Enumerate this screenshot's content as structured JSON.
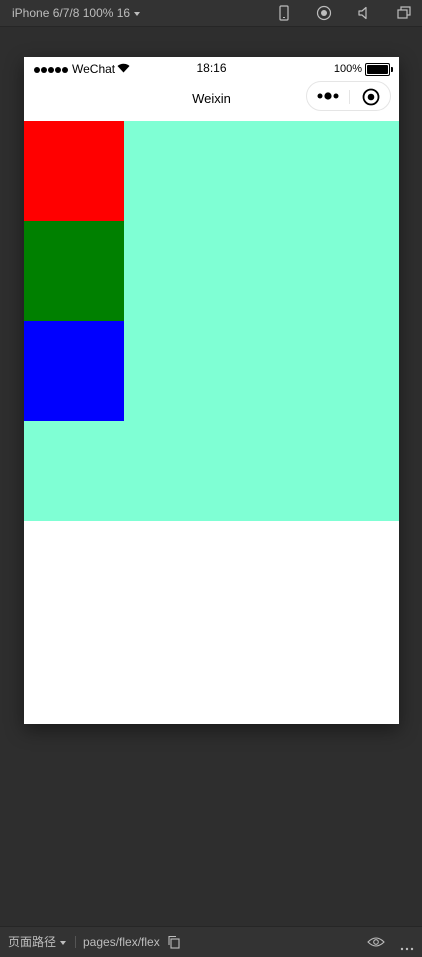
{
  "toolbar": {
    "device_label": "iPhone 6/7/8 100% 16",
    "icons": [
      "phone-icon",
      "record-icon",
      "volume-icon",
      "window-icon"
    ]
  },
  "statusbar": {
    "carrier": "WeChat",
    "time": "18:16",
    "battery": "100%"
  },
  "navbar": {
    "title": "Weixin"
  },
  "flex_demo": {
    "container_color": "#7fffd4",
    "items": [
      {
        "color": "#ff0000"
      },
      {
        "color": "#008000"
      },
      {
        "color": "#0000ff"
      }
    ]
  },
  "bottombar": {
    "path_label": "页面路径",
    "path_value": "pages/flex/flex"
  }
}
